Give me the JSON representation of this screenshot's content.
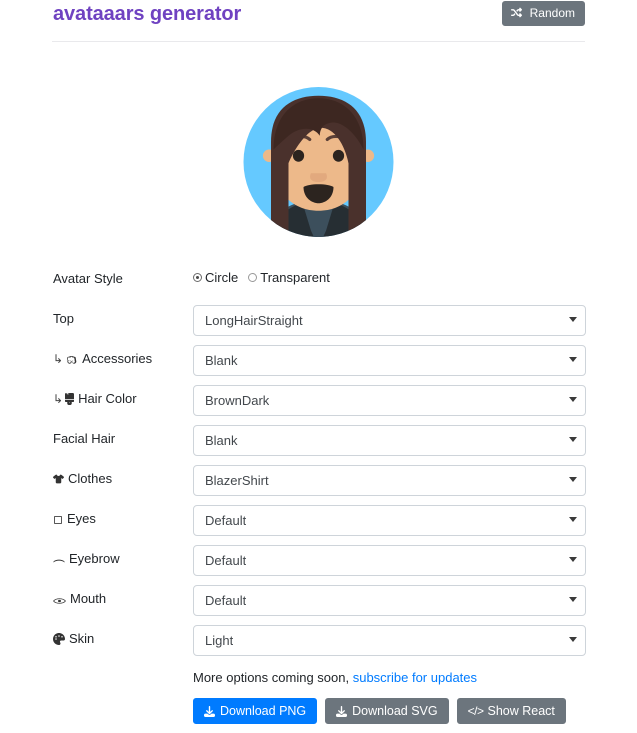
{
  "header": {
    "title": "avataaars generator",
    "random_button": {
      "label": "Random",
      "icon": "shuffle-icon"
    },
    "title_color": "#6f42c1",
    "random_button_color": "#6c757d"
  },
  "avatar": {
    "style": "Circle",
    "background_color": "#65C9FF",
    "skin_color": "#EDB98A",
    "hair_color": "#4A312C",
    "clothes_color": "#262E33",
    "mouth": "Default",
    "eyes": "Default",
    "eyebrow": "Default",
    "top": "LongHairStraight",
    "clothes": "BlazerShirt"
  },
  "form": {
    "avatar_style": {
      "label": "Avatar Style",
      "options": [
        "Circle",
        "Transparent"
      ],
      "selected": "Circle"
    },
    "rows": [
      {
        "label": "Top",
        "icon": null,
        "sub": false,
        "value": "LongHairStraight"
      },
      {
        "label": "Accessories",
        "icon": "glasses-icon",
        "sub": true,
        "value": "Blank"
      },
      {
        "label": "Hair Color",
        "icon": "paint-brush-icon",
        "sub": true,
        "value": "BrownDark"
      },
      {
        "label": "Facial Hair",
        "icon": null,
        "sub": false,
        "value": "Blank"
      },
      {
        "label": "Clothes",
        "icon": "tshirt-icon",
        "sub": false,
        "value": "BlazerShirt"
      },
      {
        "label": "Eyes",
        "icon": "eye-square-icon",
        "sub": false,
        "value": "Default"
      },
      {
        "label": "Eyebrow",
        "icon": "eyebrow-dash-icon",
        "sub": false,
        "value": "Default"
      },
      {
        "label": "Mouth",
        "icon": "mouth-icon",
        "sub": false,
        "value": "Default"
      },
      {
        "label": "Skin",
        "icon": "palette-icon",
        "sub": false,
        "value": "Light"
      }
    ],
    "sub_arrow": "↳"
  },
  "footer": {
    "note_text": "More options coming soon,",
    "note_link": "subscribe for updates",
    "link_color": "#007bff",
    "buttons": [
      {
        "label": "Download PNG",
        "icon": "download-icon",
        "style": "primary"
      },
      {
        "label": "Download SVG",
        "icon": "download-icon",
        "style": "secondary"
      },
      {
        "label": "Show React",
        "icon": "code-icon",
        "style": "secondary"
      }
    ]
  }
}
